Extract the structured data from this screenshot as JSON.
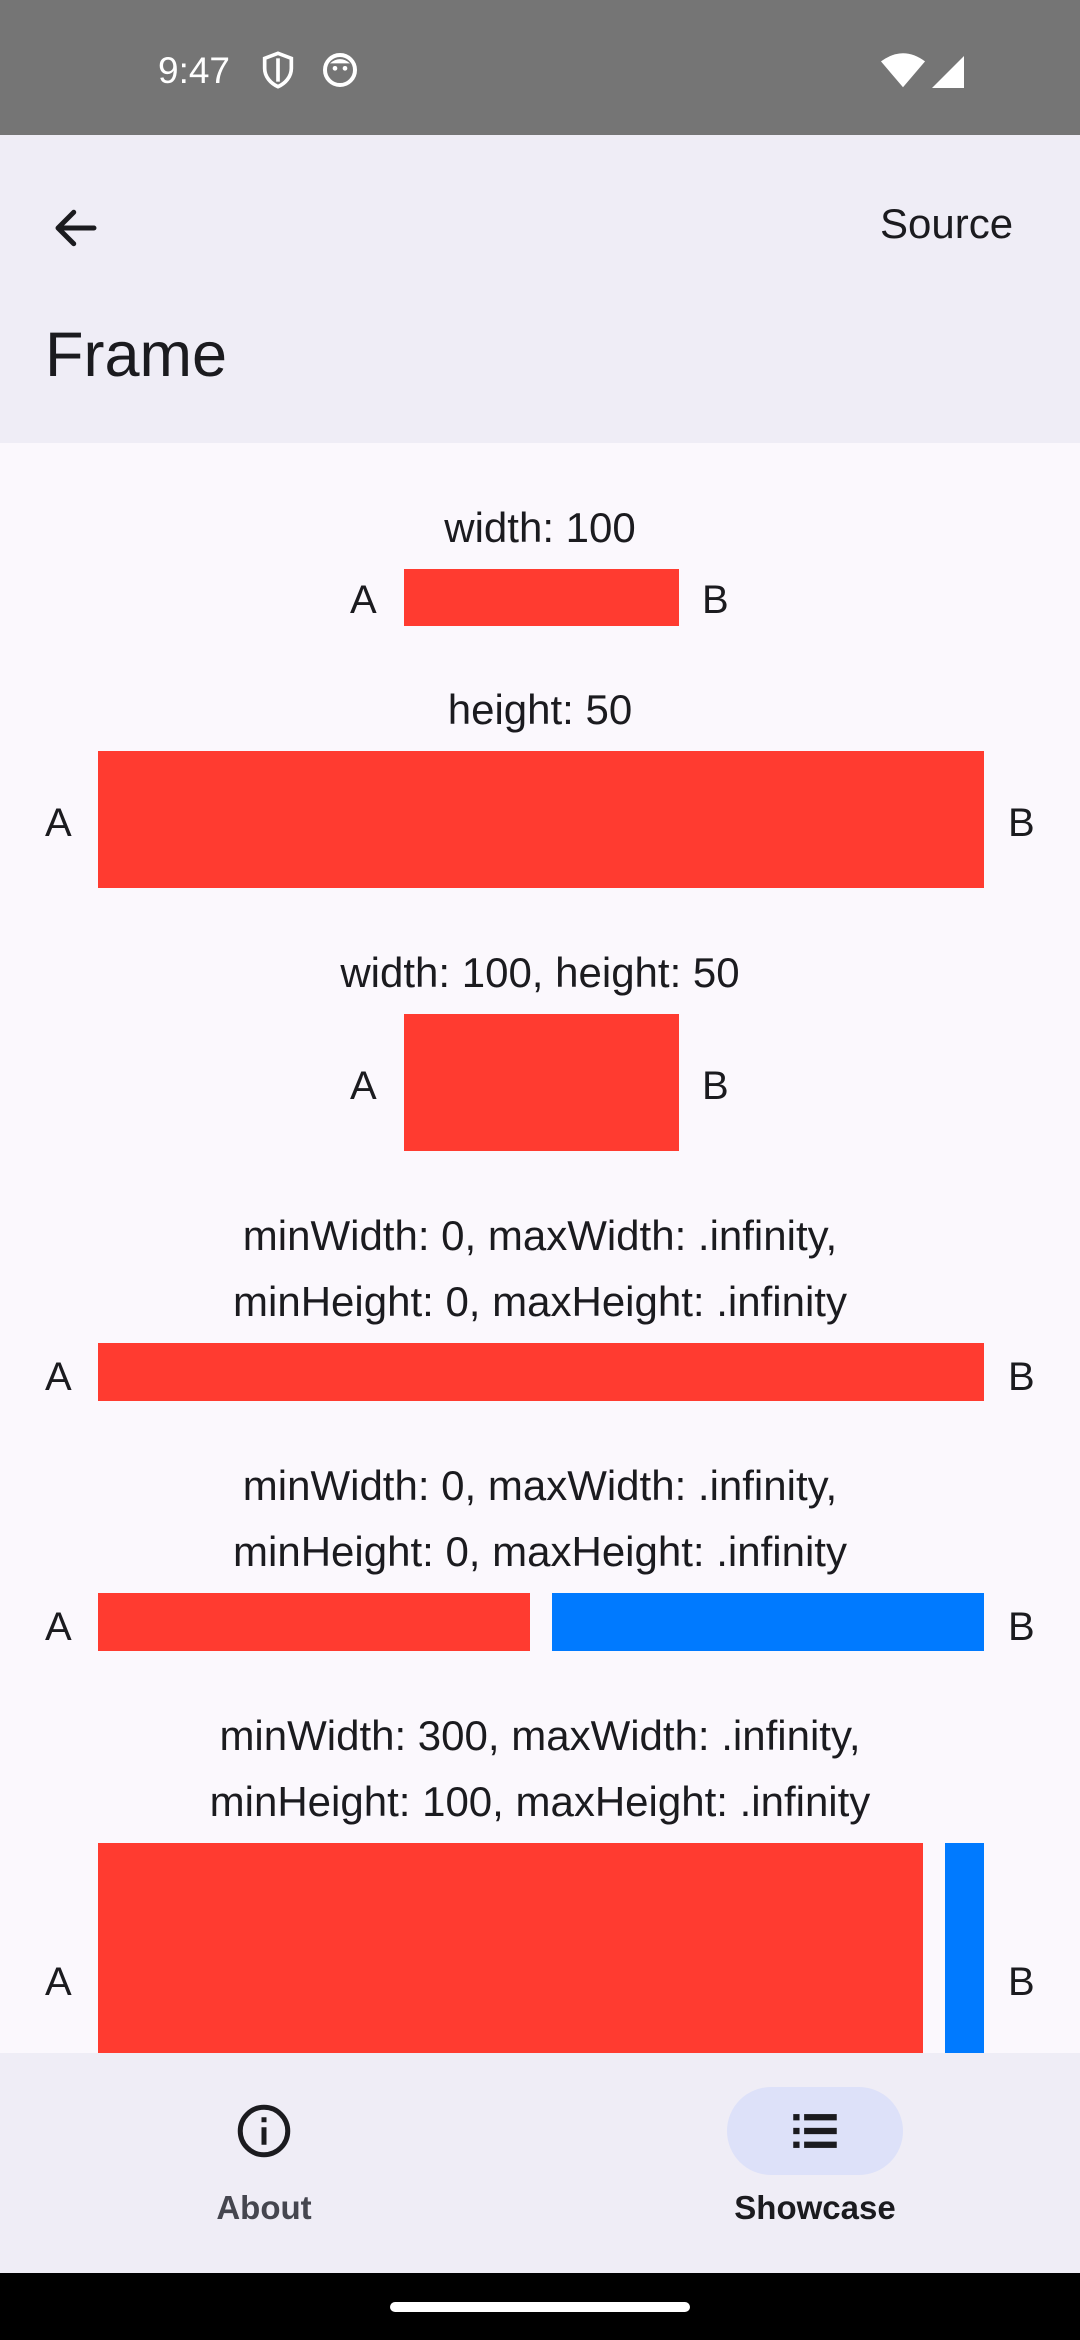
{
  "status_bar": {
    "time": "9:47",
    "icons_left": [
      "shield-icon",
      "face-icon"
    ],
    "icons_right": [
      "wifi-icon",
      "cellular-signal-icon"
    ]
  },
  "app_bar": {
    "back_icon": "arrow-back-icon",
    "source_label": "Source",
    "title": "Frame"
  },
  "demos": {
    "d1": {
      "caption": "width: 100",
      "left": "A",
      "right": "B"
    },
    "d2": {
      "caption": "height: 50",
      "left": "A",
      "right": "B"
    },
    "d3": {
      "caption": "width: 100, height: 50",
      "left": "A",
      "right": "B"
    },
    "d4": {
      "caption": "minWidth: 0, maxWidth: .infinity,\nminHeight: 0, maxHeight: .infinity",
      "left": "A",
      "right": "B"
    },
    "d5": {
      "caption": "minWidth: 0, maxWidth: .infinity,\nminHeight: 0, maxHeight: .infinity",
      "left": "A",
      "right": "B"
    },
    "d6": {
      "caption": "minWidth: 300, maxWidth: .infinity,\nminHeight: 100, maxHeight: .infinity",
      "left": "A",
      "right": "B"
    }
  },
  "colors": {
    "red": "#FF3B30",
    "blue": "#007AFF",
    "nav_active_pill": "#DDE1F9"
  },
  "bottom_nav": {
    "items": [
      {
        "label": "About",
        "icon": "info-icon",
        "active": false
      },
      {
        "label": "Showcase",
        "icon": "list-icon",
        "active": true
      }
    ]
  }
}
